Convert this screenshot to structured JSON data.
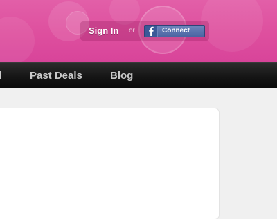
{
  "header": {
    "sign_in_label": "Sign In",
    "or_label": "or",
    "facebook_connect_label": "Connect",
    "facebook_icon": "facebook-f-icon",
    "brand_color": "#de4f9e"
  },
  "nav": {
    "items": [
      {
        "label": "l"
      },
      {
        "label": "Past Deals"
      },
      {
        "label": "Blog"
      }
    ],
    "background_color": "#151515"
  },
  "content": {
    "panel_color": "#ffffff"
  }
}
